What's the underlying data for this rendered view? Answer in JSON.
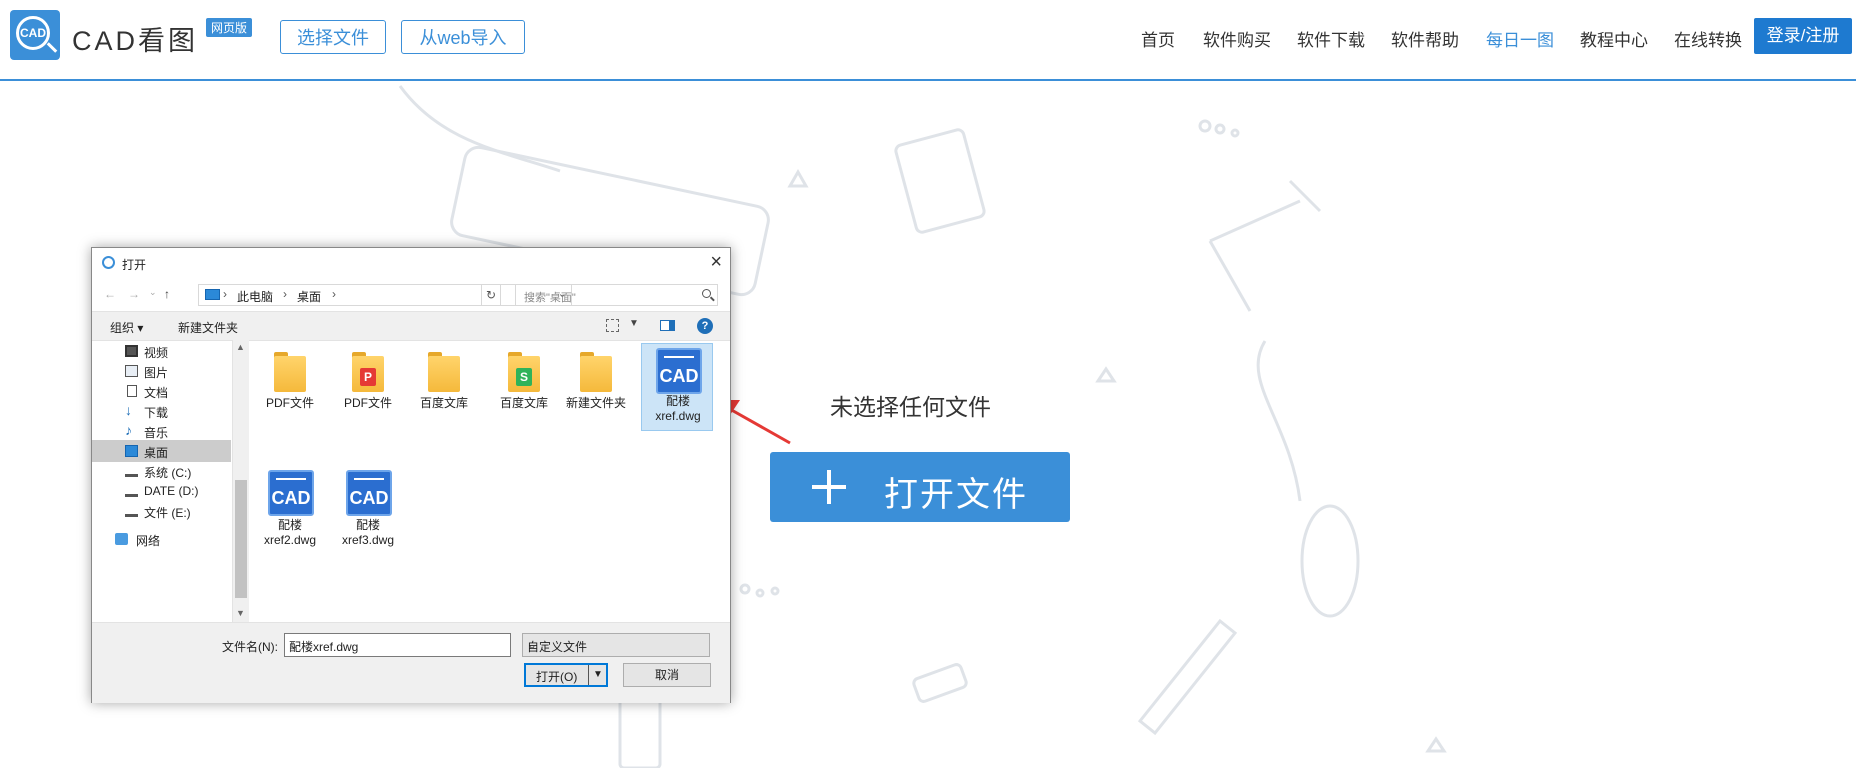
{
  "header": {
    "logo_text": "CAD",
    "brand": "CAD看图",
    "badge": "网页版",
    "select_file": "选择文件",
    "web_import": "从web导入",
    "nav": [
      "首页",
      "软件购买",
      "软件下载",
      "软件帮助",
      "每日一图",
      "教程中心",
      "在线转换"
    ],
    "active_nav": "每日一图",
    "login": "登录/注册"
  },
  "main": {
    "no_file": "未选择任何文件",
    "open_file": "打开文件"
  },
  "dialog": {
    "title": "打开",
    "breadcrumb": [
      "此电脑",
      "桌面"
    ],
    "search_placeholder": "搜索\"桌面\"",
    "organize": "组织 ▾",
    "new_folder": "新建文件夹",
    "help": "?",
    "nav_items": [
      {
        "label": "视频",
        "icon": "video-icon"
      },
      {
        "label": "图片",
        "icon": "picture-icon"
      },
      {
        "label": "文档",
        "icon": "document-icon"
      },
      {
        "label": "下载",
        "icon": "download-icon"
      },
      {
        "label": "音乐",
        "icon": "music-icon"
      },
      {
        "label": "桌面",
        "icon": "desktop-icon",
        "selected": true
      },
      {
        "label": "系统 (C:)",
        "icon": "drive-icon"
      },
      {
        "label": "DATE (D:)",
        "icon": "drive-icon"
      },
      {
        "label": "文件 (E:)",
        "icon": "drive-icon"
      },
      {
        "label": "网络",
        "icon": "network-icon"
      }
    ],
    "files": [
      {
        "name": "PDF文件",
        "icon": "folder-icon"
      },
      {
        "name": "PDF文件",
        "icon": "pdf-folder-icon"
      },
      {
        "name": "百度文库",
        "icon": "folder-icon"
      },
      {
        "name": "百度文库",
        "icon": "wps-folder-icon"
      },
      {
        "name": "新建文件夹",
        "icon": "folder-icon"
      },
      {
        "name": "配楼\nxref.dwg",
        "icon": "cad-file-icon",
        "selected": true
      },
      {
        "name": "配楼\nxref2.dwg",
        "icon": "cad-file-icon"
      },
      {
        "name": "配楼\nxref3.dwg",
        "icon": "cad-file-icon"
      }
    ],
    "cad_icon_text": "CAD",
    "filename_label": "文件名(N):",
    "filename_value": "配楼xref.dwg",
    "filetype": "自定义文件",
    "open_button": "打开(O)",
    "cancel_button": "取消"
  },
  "colors": {
    "accent": "#3b8fd8",
    "login_bg": "#1e7ad0",
    "arrow": "#e53935"
  }
}
